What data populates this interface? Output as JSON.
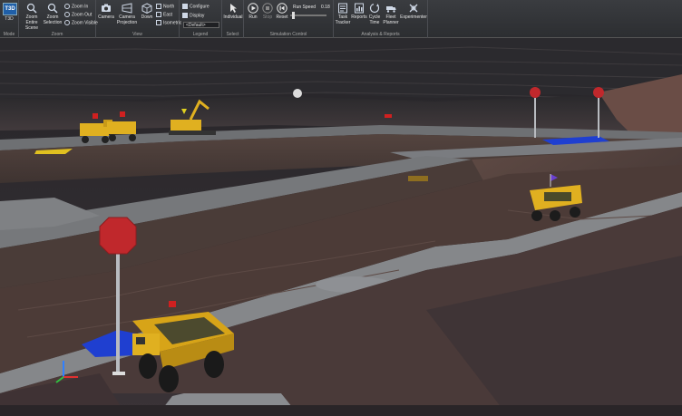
{
  "app": {
    "logo_text": "T3D",
    "logo_label": "T3D"
  },
  "ribbon": {
    "groups": {
      "mode": "Mode",
      "zoom": "Zoom",
      "view": "View",
      "legend": "Legend",
      "select": "Select",
      "simulation": "Simulation Control",
      "analysis": "Analysis & Reports"
    },
    "zoom_entire_scene": "Zoom Entire Scene",
    "zoom_selection": "Zoom Selection",
    "zoom_in": "Zoom In",
    "zoom_out": "Zoom Out",
    "zoom_visible": "Zoom Visible",
    "camera": "Camera",
    "camera_projection": "Camera Projection",
    "down": "Down",
    "north": "North",
    "east": "East",
    "isometric": "Isometric",
    "configure": "Configure",
    "display": "Display",
    "legend_default": "<Default>",
    "individual": "Individual",
    "run": "Run",
    "stop": "Stop",
    "reset": "Reset",
    "run_speed_label": "Run Speed",
    "run_speed_value": "0.18",
    "task_tracker": "Task Tracker",
    "reports": "Reports",
    "cycle_time": "Cycle Time",
    "fleet_planner": "Fleet Planner",
    "experimenter": "Experimenter"
  },
  "colors": {
    "ribbon_bg": "#2f3134",
    "haul_truck": "#e0b020",
    "road": "#7d7f82",
    "stop_sign": "#c0282c",
    "dump_zone": "#1f3fd0"
  }
}
